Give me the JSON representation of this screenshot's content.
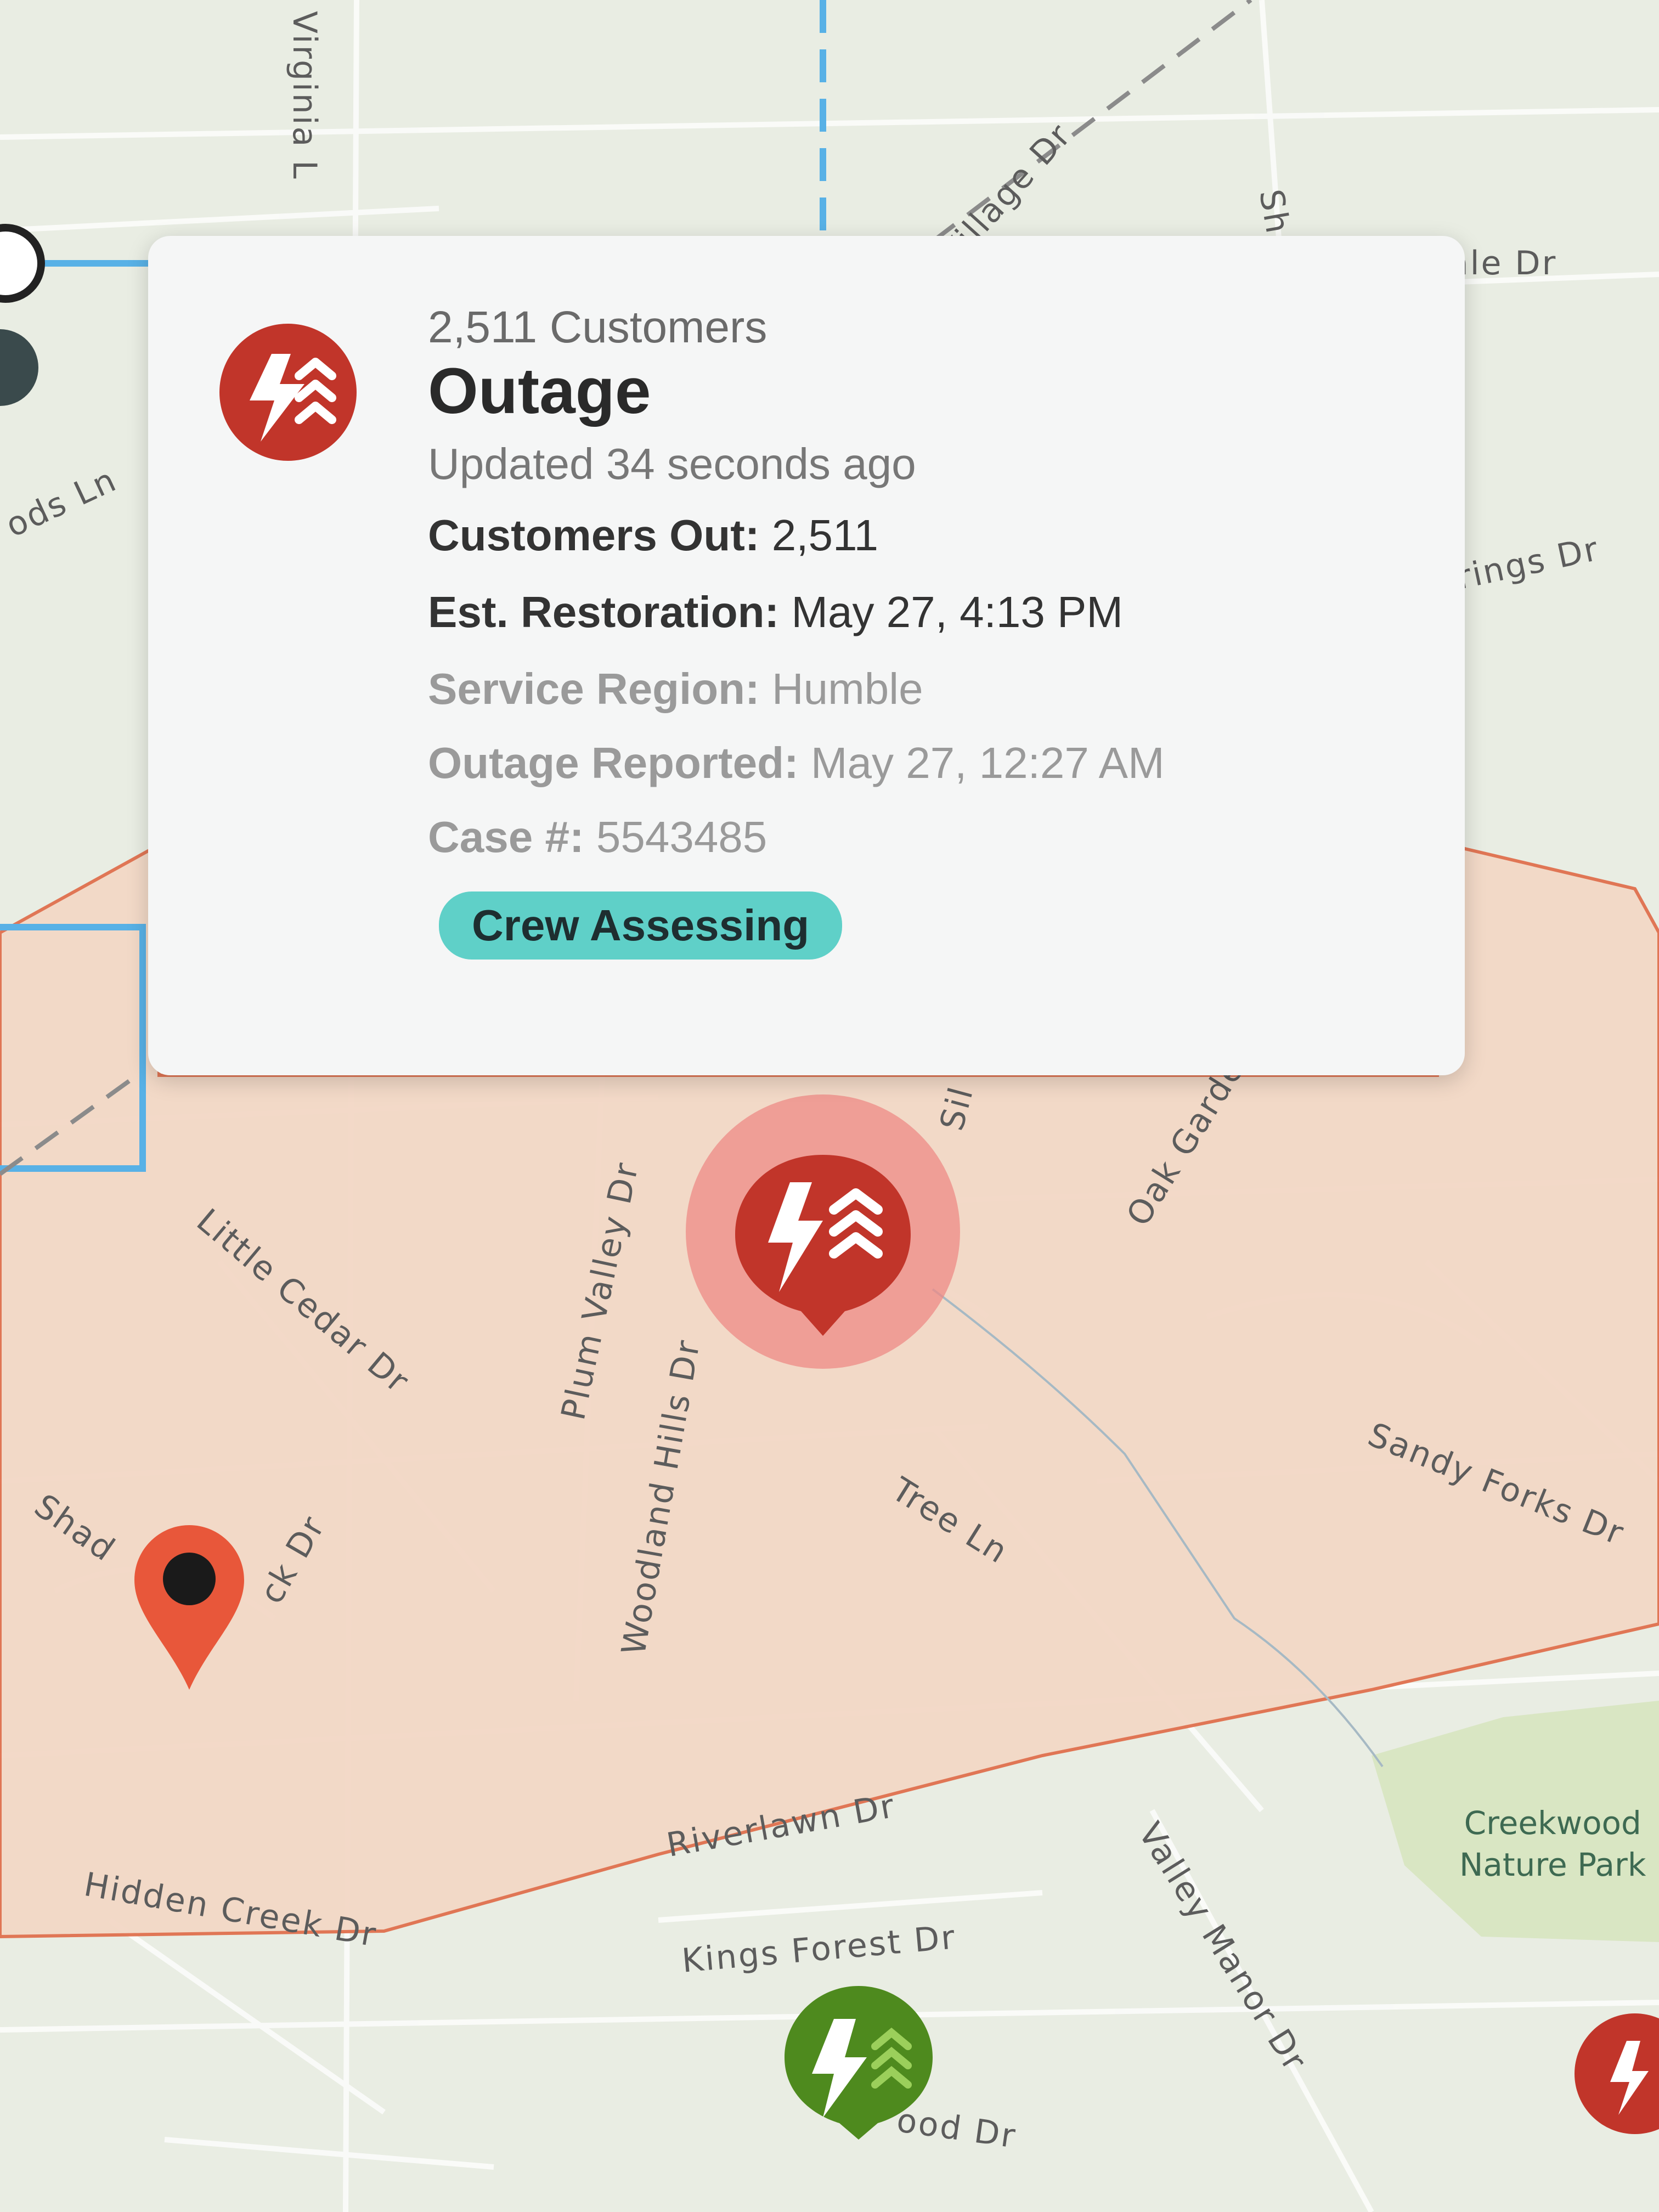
{
  "popup": {
    "customers_text": "2,511 Customers",
    "title": "Outage",
    "updated": "Updated 34 seconds ago",
    "fields": [
      {
        "label": "Customers Out:",
        "value": "2,511"
      },
      {
        "label": "Est. Restoration:",
        "value": "May 27, 4:13 PM"
      },
      {
        "label": "Service Region:",
        "value": "Humble"
      },
      {
        "label": "Outage Reported:",
        "value": "May 27, 12:27 AM"
      },
      {
        "label": "Case #:",
        "value": "5543485"
      }
    ],
    "status": "Crew Assessing",
    "icon": "outage-lightning-icon"
  },
  "streets": {
    "virginia": "Virginia L",
    "village": "Village Dr",
    "sh": "Sh",
    "ale": "ale Dr",
    "woods": "ods Ln",
    "springs": "rings Dr",
    "oak_garden": "Oak Garde",
    "sil": "Sil",
    "plum_valley": "Plum Valley Dr",
    "little_cedar": "Little Cedar Dr",
    "woodland_hills": "Woodland Hills Dr",
    "tree": "Tree Ln",
    "sandy_forks": "Sandy Forks Dr",
    "shad": "Shad",
    "ck": "ck Dr",
    "riverlawn": "Riverlawn Dr",
    "hidden_creek": "Hidden Creek Dr",
    "kings_forest": "Kings Forest Dr",
    "valley_manor": "Valley Manor Dr",
    "ood": "ood Dr"
  },
  "park": {
    "line1": "Creekwood",
    "line2": "Nature Park"
  },
  "colors": {
    "outage_red": "#c1352a",
    "restored_green": "#4e8a1e",
    "status_teal": "#5fd0c8",
    "area_fill": "#f3d8c6",
    "area_border": "#e0704e",
    "pin_orange": "#e8573a"
  }
}
